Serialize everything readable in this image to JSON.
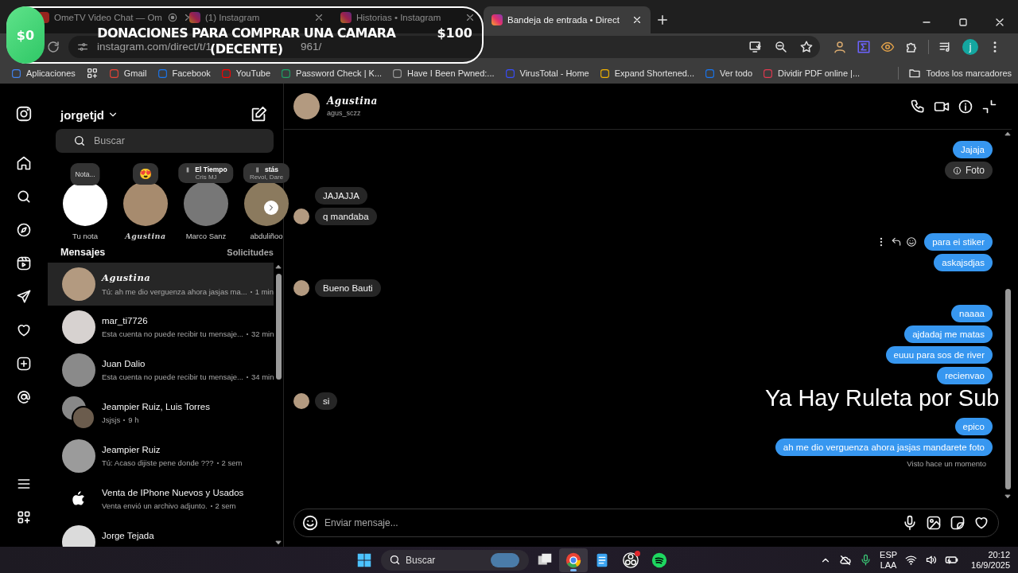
{
  "browser": {
    "tabs": [
      {
        "title": "OmeTV Video Chat — Om",
        "kind": "ometv",
        "media_icon": true,
        "selected": false
      },
      {
        "title": "(1) Instagram",
        "kind": "instagram",
        "media_icon": false,
        "selected": false
      },
      {
        "title": "Historias • Instagram",
        "kind": "instagram",
        "media_icon": false,
        "selected": false
      },
      {
        "title": "Bandeja de entrada • Direct",
        "kind": "instagram",
        "media_icon": false,
        "selected": true
      }
    ],
    "url_start": "instagram.com/direct/t/1",
    "url_end": "961/",
    "profile_initial": "j",
    "bookmarks": [
      {
        "label": "Aplicaciones",
        "kind": "apps"
      },
      {
        "label": "Gmail",
        "kind": "gmail"
      },
      {
        "label": "Facebook",
        "kind": "facebook"
      },
      {
        "label": "YouTube",
        "kind": "youtube"
      },
      {
        "label": "Password Check | K...",
        "kind": "kaspersky"
      },
      {
        "label": "Have I Been Pwned:...",
        "kind": "pwned"
      },
      {
        "label": "VirusTotal - Home",
        "kind": "virustotal"
      },
      {
        "label": "Expand Shortened...",
        "kind": "expand"
      },
      {
        "label": "Ver todo",
        "kind": "facebook"
      },
      {
        "label": "Dividir PDF online |...",
        "kind": "pdf"
      }
    ],
    "all_bookmarks": "Todos los marcadores"
  },
  "instagram": {
    "username": "jorgetjd",
    "search_placeholder": "Buscar",
    "stories": [
      {
        "kind": "own",
        "note": "Nota...",
        "label": "Tu nota",
        "script_name": false
      },
      {
        "kind": "emoji",
        "note": "😍",
        "label": "Agustina",
        "script_name": true
      },
      {
        "kind": "music",
        "note": "El Tiempo",
        "artist": "Cris MJ",
        "label": "Marco Sanz",
        "script_name": false
      },
      {
        "kind": "music",
        "note": "stás",
        "artist": "Revol, Dare",
        "label": "abduliñoo",
        "script_name": false
      }
    ],
    "messages_label": "Mensajes",
    "requests_label": "Solicitudes",
    "conversations": [
      {
        "name": "Agustina",
        "preview": "Tú: ah me dio verguenza ahora jasjas ma...",
        "time": "1 min",
        "kind": "photo",
        "script_name": true,
        "selected": true
      },
      {
        "name": "mar_ti7726",
        "preview": "Esta cuenta no puede recibir tu mensaje...",
        "time": "32 min",
        "kind": "photo",
        "script_name": false,
        "selected": false
      },
      {
        "name": "Juan Dalio",
        "preview": "Esta cuenta no puede recibir tu mensaje...",
        "time": "34 min",
        "kind": "photo",
        "script_name": false,
        "selected": false
      },
      {
        "name": "Jeampier Ruiz, Luis Torres",
        "preview": "Jsjsjs",
        "time": "9 h",
        "kind": "group",
        "script_name": false,
        "selected": false
      },
      {
        "name": "Jeampier Ruiz",
        "preview": "Tú: Acaso dijiste pene donde ???",
        "time": "2 sem",
        "kind": "photo",
        "script_name": false,
        "selected": false
      },
      {
        "name": "Venta de IPhone Nuevos y Usados",
        "preview": "Venta envió un archivo adjunto.",
        "time": "2 sem",
        "kind": "logo",
        "script_name": false,
        "selected": false
      },
      {
        "name": "Jorge Tejada",
        "kind": "blank",
        "script_name": false,
        "selected": false
      }
    ]
  },
  "chat": {
    "name": "Agustina",
    "handle": "agus_sczz",
    "script_name": true,
    "groups": [
      {
        "kind": "sent",
        "messages": [
          {
            "kind": "text",
            "text": "Jajaja"
          },
          {
            "kind": "attachment",
            "text": "Foto"
          }
        ]
      },
      {
        "kind": "received",
        "messages": [
          {
            "kind": "text",
            "text": "JAJAJJA"
          },
          {
            "kind": "text",
            "text": "q mandaba"
          }
        ]
      },
      {
        "kind": "sent",
        "messages": [
          {
            "kind": "text",
            "text": "para ei stiker",
            "actions": true
          },
          {
            "kind": "text",
            "text": "askajsdjas"
          }
        ]
      },
      {
        "kind": "received",
        "messages": [
          {
            "kind": "text",
            "text": "Bueno Bauti"
          }
        ]
      },
      {
        "kind": "sent",
        "messages": [
          {
            "kind": "text",
            "text": "naaaa"
          },
          {
            "kind": "text",
            "text": "ajdadaj me matas"
          },
          {
            "kind": "text",
            "text": "euuu para sos de river"
          },
          {
            "kind": "text",
            "text": "recienvao"
          }
        ]
      },
      {
        "kind": "received",
        "messages": [
          {
            "kind": "text",
            "text": "si"
          }
        ]
      },
      {
        "kind": "sent",
        "messages": [
          {
            "kind": "text",
            "text": "epico"
          },
          {
            "kind": "text",
            "text": "ah me dio verguenza ahora jasjas mandarete foto"
          }
        ]
      }
    ],
    "seen": "Visto hace un momento",
    "input_placeholder": "Enviar mensaje..."
  },
  "taskbar": {
    "search_placeholder": "Buscar",
    "apps": [
      {
        "kind": "taskview",
        "badge": false,
        "selected": false
      },
      {
        "kind": "chrome",
        "badge": false,
        "selected": true
      },
      {
        "kind": "notepad",
        "badge": false,
        "selected": false
      },
      {
        "kind": "obs",
        "badge": true,
        "selected": false
      },
      {
        "kind": "spotify",
        "badge": false,
        "selected": false
      }
    ],
    "language": "ESP",
    "layout": "LAA",
    "time": "20:12",
    "date": "16/9/2025"
  },
  "overlay": {
    "start_amount": "$0",
    "goal_title": "DONACIONES PARA COMPRAR UNA CAMARA",
    "goal_subtitle": "(DECENTE)",
    "target_amount": "$100",
    "banner": "Ya Hay Ruleta por Sub"
  }
}
